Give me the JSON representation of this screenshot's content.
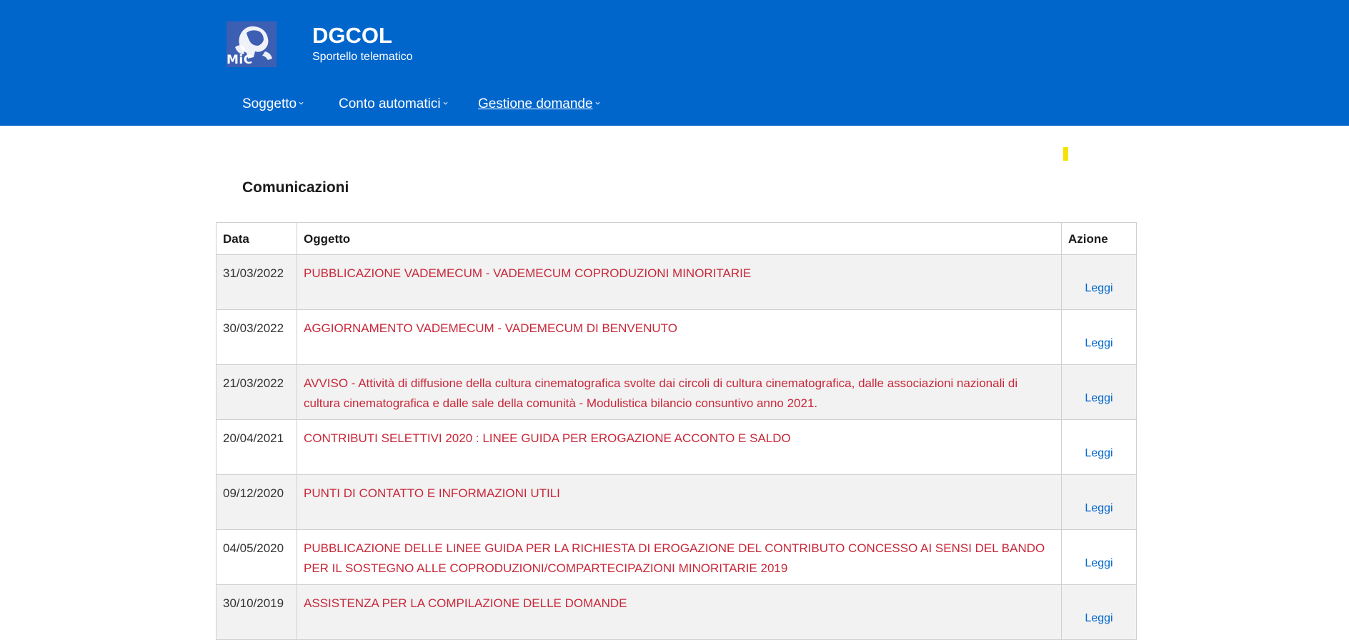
{
  "brand": {
    "logo_text": "MiC",
    "title": "DGCOL",
    "subtitle": "Sportello telematico"
  },
  "nav": {
    "items": [
      {
        "label": "Soggetto"
      },
      {
        "label": "Conto automatici"
      },
      {
        "label": "Gestione domande"
      }
    ]
  },
  "section": {
    "title": "Comunicazioni"
  },
  "table": {
    "headers": {
      "date": "Data",
      "subject": "Oggetto",
      "action": "Azione"
    },
    "rows": [
      {
        "date": "31/03/2022",
        "subject": "PUBBLICAZIONE VADEMECUM - VADEMECUM COPRODUZIONI MINORITARIE",
        "action": "Leggi"
      },
      {
        "date": "30/03/2022",
        "subject": "AGGIORNAMENTO VADEMECUM - VADEMECUM DI BENVENUTO",
        "action": "Leggi"
      },
      {
        "date": "21/03/2022",
        "subject": "AVVISO - Attività di diffusione della cultura cinematografica svolte dai circoli di cultura cinematografica, dalle associazioni nazionali di cultura cinematografica e dalle sale della comunità - Modulistica bilancio consuntivo anno 2021.",
        "action": "Leggi"
      },
      {
        "date": "20/04/2021",
        "subject": "CONTRIBUTI SELETTIVI 2020 : LINEE GUIDA PER EROGAZIONE ACCONTO E SALDO",
        "action": "Leggi"
      },
      {
        "date": "09/12/2020",
        "subject": "PUNTI DI CONTATTO E INFORMAZIONI UTILI",
        "action": "Leggi"
      },
      {
        "date": "04/05/2020",
        "subject": "PUBBLICAZIONE DELLE LINEE GUIDA PER LA RICHIESTA DI EROGAZIONE DEL CONTRIBUTO CONCESSO AI SENSI DEL BANDO PER IL SOSTEGNO ALLE COPRODUZIONI/COMPARTECIPAZIONI MINORITARIE 2019",
        "action": "Leggi"
      },
      {
        "date": "30/10/2019",
        "subject": "ASSISTENZA PER LA COMPILAZIONE DELLE DOMANDE",
        "action": "Leggi"
      }
    ]
  },
  "colors": {
    "header_bg": "#0066cc",
    "subject_text": "#c8283a",
    "link": "#0066cc",
    "row_alt": "#f2f2f2",
    "marker": "#f4e300"
  }
}
